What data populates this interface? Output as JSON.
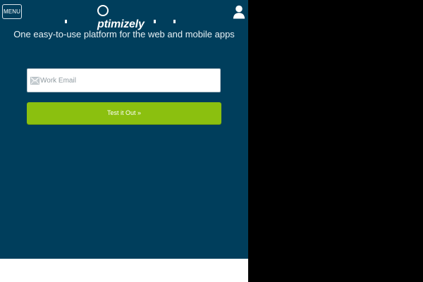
{
  "header": {
    "menu_label": "MENU",
    "logo_text": "ptimizely",
    "icons": {
      "user": "user-icon"
    }
  },
  "hero": {
    "tagline": "One easy-to-use platform for the web and mobile apps"
  },
  "signup": {
    "email_placeholder": "Work Email",
    "email_value": "",
    "submit_label": "Test it Out »",
    "icons": {
      "email": "mail-icon"
    }
  },
  "colors": {
    "background": "#003e5c",
    "accent": "#8bc00f",
    "outside": "#000000"
  }
}
